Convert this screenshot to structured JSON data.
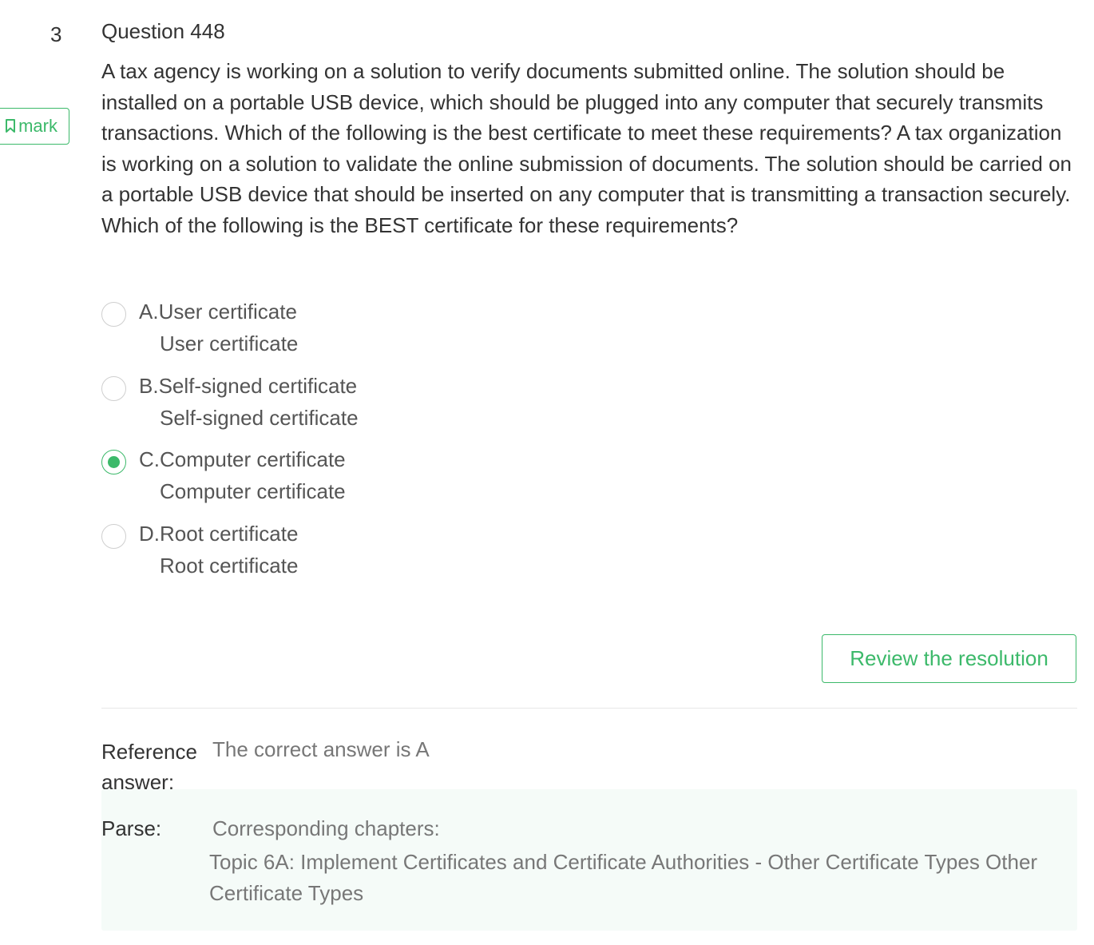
{
  "question": {
    "number": "3",
    "title": "Question 448",
    "mark_label": "mark",
    "stem": "A tax agency is working on a solution to verify documents submitted online. The solution should be installed on a portable USB device, which should be plugged into any computer that securely transmits transactions. Which of the following is the best certificate to meet these requirements? A tax organization is working on a solution to validate the online submission of documents. The solution should be carried on a portable USB device that should be inserted on any computer that is transmitting a transaction securely. Which of the following is the BEST certificate for these requirements?"
  },
  "options": [
    {
      "label": "A.User certificate",
      "sub": "User certificate",
      "selected": false
    },
    {
      "label": "B.Self-signed certificate",
      "sub": "Self-signed certificate",
      "selected": false
    },
    {
      "label": "C.Computer certificate",
      "sub": "Computer certificate",
      "selected": true
    },
    {
      "label": "D.Root certificate",
      "sub": "Root certificate",
      "selected": false
    }
  ],
  "review_button": "Review the resolution",
  "reference": {
    "label": "Reference answer:",
    "value": "The correct answer is A"
  },
  "parse": {
    "label": "Parse:",
    "heading": "Corresponding chapters:",
    "chapter": "Topic 6A: Implement Certificates and Certificate Authorities - Other Certificate Types Other Certificate Types"
  },
  "colors": {
    "accent": "#3cb96a",
    "parse_bg": "#f5fbf8"
  }
}
